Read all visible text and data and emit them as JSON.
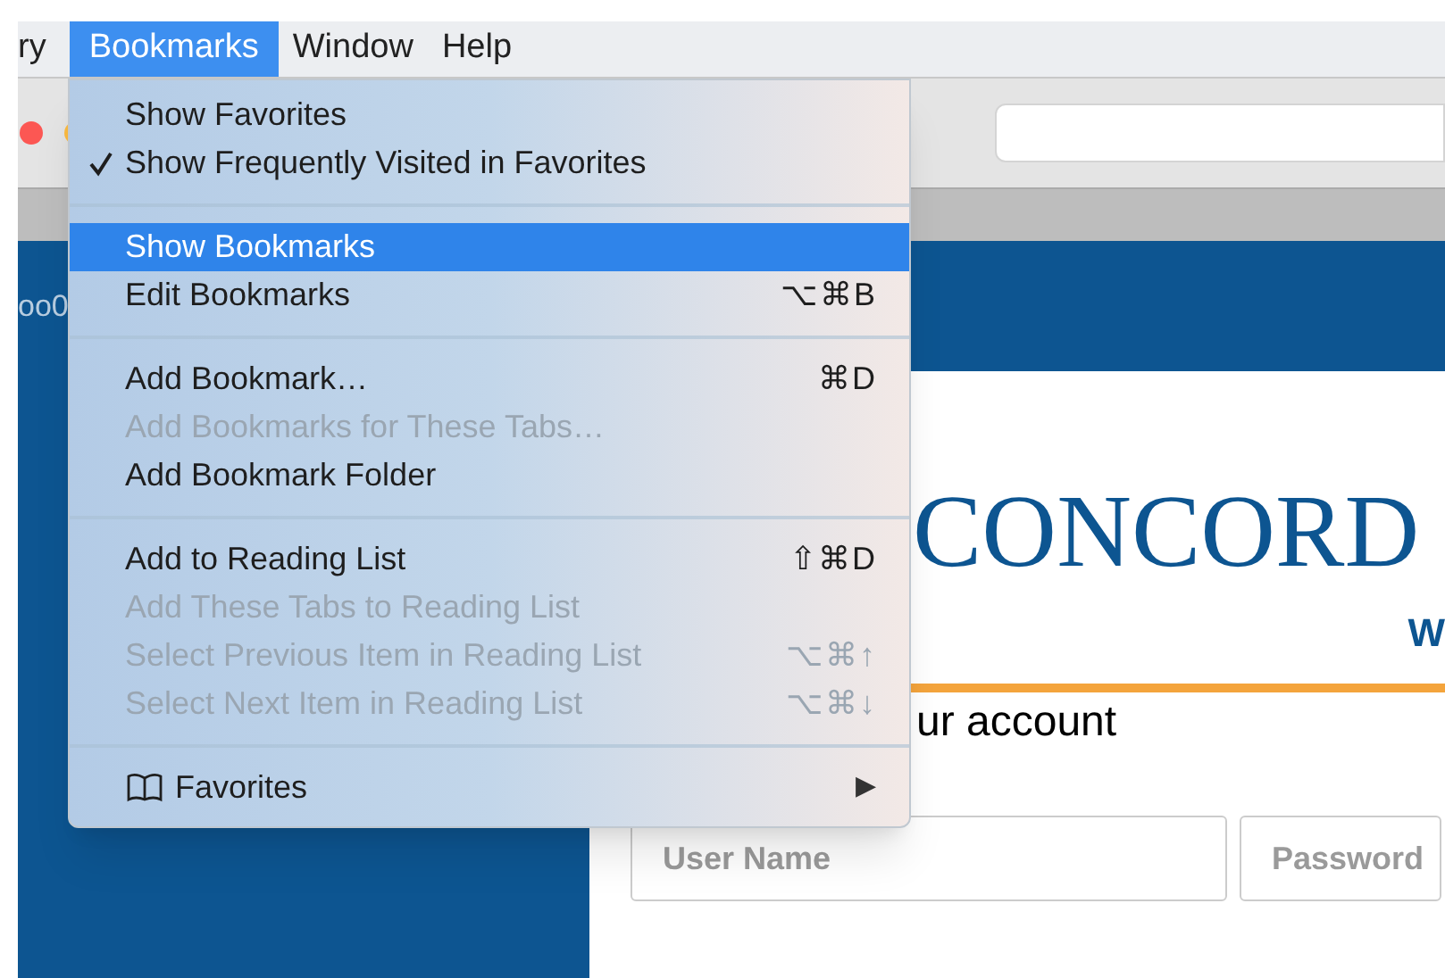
{
  "menu_bar": [
    {
      "label": "ry",
      "selected": false
    },
    {
      "label": "Bookmarks",
      "selected": true
    },
    {
      "label": "Window",
      "selected": false
    },
    {
      "label": "Help",
      "selected": false
    }
  ],
  "bookmarks_menu": [
    {
      "kind": "item",
      "label": "Show Favorites",
      "checked": false,
      "disabled": false,
      "selected": false
    },
    {
      "kind": "item",
      "label": "Show Frequently Visited in Favorites",
      "checked": true,
      "disabled": false,
      "selected": false
    },
    {
      "kind": "separator"
    },
    {
      "kind": "item",
      "label": "Show Bookmarks",
      "checked": false,
      "disabled": false,
      "selected": true
    },
    {
      "kind": "item",
      "label": "Edit Bookmarks",
      "shortcut": "⌥⌘B",
      "checked": false,
      "disabled": false,
      "selected": false
    },
    {
      "kind": "separator"
    },
    {
      "kind": "item",
      "label": "Add Bookmark…",
      "shortcut": "⌘D",
      "checked": false,
      "disabled": false,
      "selected": false
    },
    {
      "kind": "item",
      "label": "Add Bookmarks for These Tabs…",
      "checked": false,
      "disabled": true,
      "selected": false
    },
    {
      "kind": "item",
      "label": "Add Bookmark Folder",
      "checked": false,
      "disabled": false,
      "selected": false
    },
    {
      "kind": "separator"
    },
    {
      "kind": "item",
      "label": "Add to Reading List",
      "shortcut": "⇧⌘D",
      "checked": false,
      "disabled": false,
      "selected": false
    },
    {
      "kind": "item",
      "label": "Add These Tabs to Reading List",
      "checked": false,
      "disabled": true,
      "selected": false
    },
    {
      "kind": "item",
      "label": "Select Previous Item in Reading List",
      "shortcut": "⌥⌘↑",
      "checked": false,
      "disabled": true,
      "selected": false
    },
    {
      "kind": "item",
      "label": "Select Next Item in Reading List",
      "shortcut": "⌥⌘↓",
      "checked": false,
      "disabled": true,
      "selected": false
    },
    {
      "kind": "separator"
    },
    {
      "kind": "submenu",
      "label": "Favorites",
      "arrow": "▶",
      "checked": false,
      "disabled": false,
      "selected": false
    }
  ],
  "page": {
    "header_text": "oo0",
    "logo": "CONCORD",
    "tagline": "W",
    "heading": "ur account",
    "fields": [
      {
        "placeholder": "User Name"
      },
      {
        "placeholder": "Password"
      }
    ]
  }
}
